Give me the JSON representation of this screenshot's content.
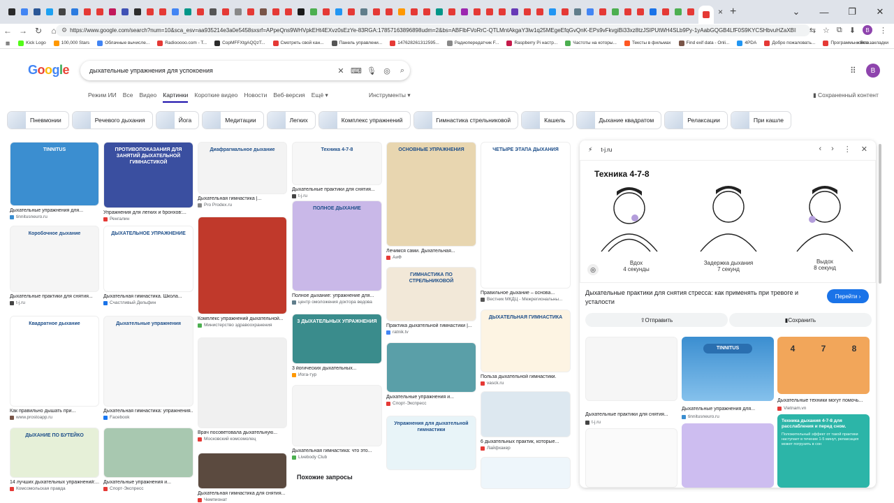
{
  "browser": {
    "tab_icons": [
      "#2a2a2a",
      "#4285f4",
      "#2b5797",
      "#1da1f2",
      "#444",
      "#2b7be0",
      "#e53935",
      "#e53935",
      "#c2185b",
      "#3f51b5",
      "#2d2d2d",
      "#e53935",
      "#e53935",
      "#4285f4",
      "#009688",
      "#e53935",
      "#555",
      "#e53935",
      "#888",
      "#e53935",
      "#795548",
      "#e53935",
      "#e53935",
      "#1a1a1a",
      "#4caf50",
      "#e53935",
      "#2196f3",
      "#e53935",
      "#607d8b",
      "#e53935",
      "#e53935",
      "#ff9800",
      "#e53935",
      "#e53935",
      "#009688",
      "#e53935",
      "#9c27b0",
      "#e53935",
      "#e53935",
      "#e53935",
      "#673ab7",
      "#e53935",
      "#e53935",
      "#2196f3",
      "#e53935",
      "#607d8b",
      "#4285f4",
      "#e53935",
      "#4caf50",
      "#e53935",
      "#e53935",
      "#1a73e8",
      "#e53935",
      "#4caf50",
      "#e53935"
    ],
    "new_tab_label": "+",
    "close_label": "×",
    "window_controls": [
      "⌄",
      "—",
      "❐",
      "✕"
    ],
    "url": "https://www.google.com/search?num=10&sca_esv=aa935214e3a0e5458sxsrf=APpeQns9WHVpkEHt4EXvz0sEzYe-83RGA:17857163896898udm=2&bs=ABFlbFVoRrC-QTLMntAkgaY3lw1q25MEgeEfqGvQnK-EPs9vFkvgiBi33xz8tzJSIPUtWH4SLb9Py-1yAabGQGB4LfF0S9KYCSHbvuHZaXBID_j52BUfAZgjHUUnr1Lhw-NMvQnvru1p9cnoaftaJOBnCi",
    "bookmarks": [
      {
        "label": "Kick Logo",
        "color": "#53fc18"
      },
      {
        "label": "100,000 Stars",
        "color": "#ff9800"
      },
      {
        "label": "Облачные вычисле...",
        "color": "#4285f4"
      },
      {
        "label": "Radiooooo.com - T...",
        "color": "#e53935"
      },
      {
        "label": "СорМFFXtgAQQzT...",
        "color": "#2b2b2b"
      },
      {
        "label": "Смотреть свой кан...",
        "color": "#e53935"
      },
      {
        "label": "Панель управлени...",
        "color": "#555"
      },
      {
        "label": "147628261312595...",
        "color": "#e53935"
      },
      {
        "label": "Радиопередатчик F...",
        "color": "#888"
      },
      {
        "label": "Raspberry Pi настр...",
        "color": "#c51a4a"
      },
      {
        "label": "Частоты на которы...",
        "color": "#4caf50"
      },
      {
        "label": "Тексты в фильмах",
        "color": "#ff5722"
      },
      {
        "label": "Find exif data - Onli...",
        "color": "#795548"
      },
      {
        "label": "4PDA",
        "color": "#2196f3"
      },
      {
        "label": "Добро пожаловать...",
        "color": "#e53935"
      },
      {
        "label": "Программы компа...",
        "color": "#e53935"
      }
    ],
    "all_bookmarks": "Все закладки"
  },
  "google": {
    "logo": [
      "G",
      "o",
      "o",
      "g",
      "l",
      "e"
    ],
    "query": "дыхательные упражнения для успокоения",
    "avatar_letter": "B",
    "tabs": [
      "Режим ИИ",
      "Все",
      "Видео",
      "Картинки",
      "Короткие видео",
      "Новости",
      "Веб-версия",
      "Ещё ▾"
    ],
    "active_tab": "Картинки",
    "tools": "Инструменты ▾",
    "saved": "Сохраненный контент"
  },
  "chips": [
    "Пневмонии",
    "Речевого дыхания",
    "Йога",
    "Медитации",
    "Легких",
    "Комплекс упражнений",
    "Гимнастика стрельниковой",
    "Кашель",
    "Дыхание квадратом",
    "Релаксации",
    "При кашле"
  ],
  "grid": [
    {
      "cap": "Дыхательные упражнения для...",
      "src": "tinnitusneuro.ru",
      "color": "#3b8ed0",
      "title": "TINNITUS"
    },
    {
      "cap": "Упражнения для легких и бронхов:...",
      "src": "Ренгалин",
      "color": "#3a4fa0",
      "title": "ПРОТИВОПОКАЗАНИЯ ДЛЯ ЗАНЯТИЙ ДЫХАТЕЛЬНОЙ ГИМНАСТИКОЙ"
    },
    {
      "cap": "Дыхательная гимнастика |...",
      "src": "Pro Prodex.ru",
      "color": "#f3f3f3",
      "title": "Диафрагмальное дыхание"
    },
    {
      "cap": "Дыхательные практики для снятия...",
      "src": "t-j.ru",
      "color": "#f7f7f7",
      "title": "Техника 4-7-8"
    },
    {
      "cap": "Лечимся сами. Дыхательная...",
      "src": "АиФ",
      "color": "#e8d6b0",
      "title": "ОСНОВНЫЕ УПРАЖНЕНИЯ"
    },
    {
      "cap": "Правильное дыхание – основа...",
      "src": "Вестник МКДЦ - Межрегиональны...",
      "color": "#ffffff",
      "title": "ЧЕТЫРЕ ЭТАПА ДЫХАНИЯ"
    },
    {
      "cap": "Дыхательные практики для снятия...",
      "src": "t-j.ru",
      "color": "#f5f5f5",
      "title": "Коробочное дыхание"
    },
    {
      "cap": "Дыхательная гимнастика. Школа...",
      "src": "Счастливый Дельфин",
      "color": "#ffffff",
      "title": "ДЫХАТЕЛЬНОЕ УПРАЖНЕНИЕ"
    },
    {
      "cap": "Комплекс упражнений дыхательной...",
      "src": "Министерство здравоохранения",
      "color": "#c0392b",
      "title": ""
    },
    {
      "cap": "Полное дыхание: упражнение для...",
      "src": "центр омоложения доктора ведова",
      "color": "#c9b8e8",
      "title": "ПОЛНОЕ ДЫХАНИЕ"
    },
    {
      "cap": "Практика дыхательной гимнастики |...",
      "src": "ratnik.tv",
      "color": "#f2e8d8",
      "title": "ГИМНАСТИКА ПО СТРЕЛЬНИКОВОЙ"
    },
    {
      "cap": "Польза дыхательной гимнастики.",
      "src": "vasck.ru",
      "color": "#fdf4e3",
      "title": "ДЫХАТЕЛЬНАЯ ГИМНАСТИКА"
    },
    {
      "cap": "Как правильно дышать при...",
      "src": "www.prostoapp.ru",
      "color": "#ffffff",
      "title": "Квадратное дыхание"
    },
    {
      "cap": "Дыхательная гимнастика: упражнения...",
      "src": "Facebook",
      "color": "#f7f7f7",
      "title": "Дыхательные упражнения"
    },
    {
      "cap": "Врач посоветовала дыхательную...",
      "src": "Московский комсомолец",
      "color": "#f0f0f0",
      "title": ""
    },
    {
      "cap": "3 йогических дыхательных...",
      "src": "Йога-тур",
      "color": "#3a8c8c",
      "title": "3 ДЫХАТЕЛЬНЫХ УПРАЖНЕНИЯ"
    },
    {
      "cap": "Дыхательные упражнения и...",
      "src": "Спорт-Экспресс",
      "color": "#5a9fa8",
      "title": ""
    },
    {
      "cap": "6 дыхательных практик, которые...",
      "src": "Лайфхакер",
      "color": "#dde8f0",
      "title": ""
    },
    {
      "cap": "14 лучших дыхательных упражнений:...",
      "src": "Комсомольская правда",
      "color": "#e6f0d8",
      "title": "ДЫХАНИЕ ПО БУТЕЙКО"
    },
    {
      "cap": "Дыхательные упражнения и...",
      "src": "Спорт-Экспресс",
      "color": "#a8c8b0",
      "title": ""
    },
    {
      "cap": "Дыхательная гимнастика для снятия...",
      "src": "Чемпионат",
      "color": "#5b4a3f",
      "title": ""
    },
    {
      "cap": "Дыхательная гимнастика: что это...",
      "src": "Livebody Club",
      "color": "#f5f5f5",
      "title": ""
    },
    {
      "cap": "",
      "src": "",
      "color": "#e8f4f8",
      "title": "Упражнения для дыхательной гимнастики"
    },
    {
      "cap": "",
      "src": "",
      "color": "#eef6fb",
      "title": ""
    }
  ],
  "related_label": "Похожие запросы",
  "panel": {
    "site": "t-j.ru",
    "image_title": "Техника 4-7-8",
    "steps": [
      {
        "label": "Вдох",
        "sub": "4 секунды"
      },
      {
        "label": "Задержка дыхания",
        "sub": "7 секунд"
      },
      {
        "label": "Выдох",
        "sub": "8 секунд"
      }
    ],
    "title": "Дыхательные практики для снятия стресса: как применять при тревоге и усталости",
    "go": "Перейти ›",
    "share": "Отправить",
    "save": "Сохранить",
    "related": [
      {
        "cap": "Дыхательные практики для снятия...",
        "src": "t-j.ru"
      },
      {
        "cap": "Дыхательные упражнения для...",
        "src": "tinnitusneuro.ru"
      },
      {
        "cap": "Дыхательные техники могут помочь...",
        "src": "Vietnam.vn"
      }
    ],
    "numbers": [
      "4",
      "7",
      "8"
    ],
    "green_text": "Техника дыхания 4-7-8 для расслабления и перед сном.",
    "green_sub": "Положительный эффект от такой практики наступает в течение 1-5 минут, релаксация может погрузить в сон"
  }
}
